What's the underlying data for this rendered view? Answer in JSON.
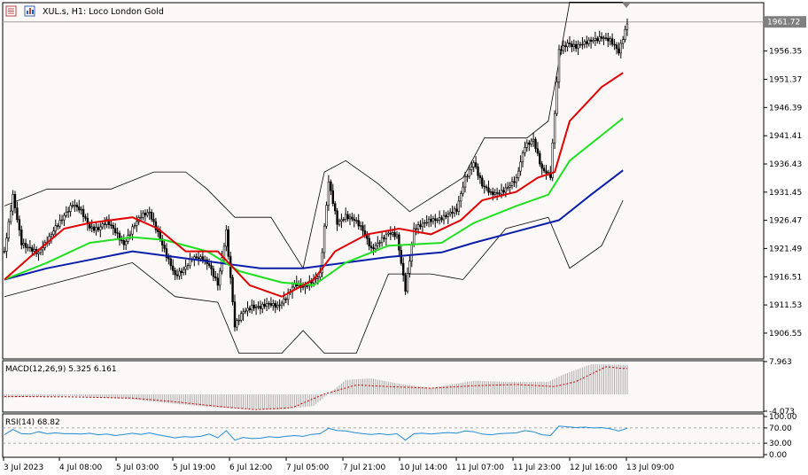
{
  "header": {
    "symbol_title": "XUL.s, H1:  Loco London Gold"
  },
  "colors": {
    "background": "#fdf8f8",
    "border": "#000000",
    "bollinger": "#000000",
    "ma_fast": "#e00000",
    "ma_mid": "#1ee01e",
    "ma_slow": "#0a1ea8",
    "macd_hist": "#a8a8a8",
    "macd_signal": "#d00000",
    "rsi_line": "#1e8cd2",
    "bid_line": "#a0a0a0",
    "bid_tag": "#808080"
  },
  "current_price_tag": "1961.72",
  "chart_data": [
    {
      "type": "candlestick",
      "price_axis_ticks": [
        "1956.35",
        "1951.37",
        "1946.39",
        "1941.41",
        "1936.43",
        "1931.45",
        "1926.47",
        "1921.49",
        "1916.51",
        "1911.53",
        "1906.55"
      ],
      "ylim": [
        1902.0,
        1964.9
      ],
      "time_axis_labels": [
        "3 Jul 2023",
        "4 Jul 08:00",
        "5 Jul 03:00",
        "5 Jul 19:00",
        "6 Jul 12:00",
        "7 Jul 05:00",
        "7 Jul 21:00",
        "10 Jul 14:00",
        "11 Jul 07:00",
        "11 Jul 23:00",
        "12 Jul 16:00",
        "13 Jul 09:00"
      ],
      "close_path": [
        [
          0,
          1921.0
        ],
        [
          4,
          1930.5
        ],
        [
          8,
          1922.5
        ],
        [
          12,
          1921.8
        ],
        [
          16,
          1920.5
        ],
        [
          20,
          1922.5
        ],
        [
          24,
          1925.5
        ],
        [
          28,
          1927.5
        ],
        [
          32,
          1929.0
        ],
        [
          36,
          1928.0
        ],
        [
          40,
          1925.5
        ],
        [
          44,
          1925.0
        ],
        [
          48,
          1926.0
        ],
        [
          52,
          1924.5
        ],
        [
          56,
          1922.5
        ],
        [
          60,
          1925.0
        ],
        [
          64,
          1927.0
        ],
        [
          68,
          1928.0
        ],
        [
          72,
          1924.5
        ],
        [
          76,
          1920.0
        ],
        [
          80,
          1916.5
        ],
        [
          84,
          1918.0
        ],
        [
          88,
          1920.0
        ],
        [
          92,
          1919.5
        ],
        [
          96,
          1918.5
        ],
        [
          100,
          1915.5
        ],
        [
          104,
          1924.5
        ],
        [
          108,
          1907.5
        ],
        [
          112,
          1910.5
        ],
        [
          116,
          1911.5
        ],
        [
          120,
          1911.0
        ],
        [
          124,
          1911.5
        ],
        [
          128,
          1911.5
        ],
        [
          132,
          1913.0
        ],
        [
          136,
          1915.0
        ],
        [
          140,
          1914.5
        ],
        [
          144,
          1916.0
        ],
        [
          148,
          1917.0
        ],
        [
          152,
          1933.0
        ],
        [
          156,
          1926.0
        ],
        [
          160,
          1927.5
        ],
        [
          164,
          1926.5
        ],
        [
          168,
          1924.5
        ],
        [
          172,
          1921.5
        ],
        [
          176,
          1923.0
        ],
        [
          180,
          1924.0
        ],
        [
          184,
          1923.5
        ],
        [
          188,
          1914.5
        ],
        [
          192,
          1925.0
        ],
        [
          196,
          1925.5
        ],
        [
          200,
          1926.5
        ],
        [
          204,
          1927.0
        ],
        [
          208,
          1927.5
        ],
        [
          212,
          1928.0
        ],
        [
          216,
          1934.0
        ],
        [
          220,
          1937.0
        ],
        [
          224,
          1932.5
        ],
        [
          228,
          1931.0
        ],
        [
          232,
          1931.5
        ],
        [
          236,
          1932.5
        ],
        [
          240,
          1933.5
        ],
        [
          244,
          1939.5
        ],
        [
          248,
          1941.0
        ],
        [
          252,
          1935.5
        ],
        [
          256,
          1934.0
        ],
        [
          260,
          1956.5
        ],
        [
          264,
          1958.0
        ],
        [
          268,
          1957.0
        ],
        [
          272,
          1957.5
        ],
        [
          276,
          1958.5
        ],
        [
          280,
          1959.0
        ],
        [
          284,
          1958.0
        ],
        [
          288,
          1956.0
        ],
        [
          292,
          1961.5
        ]
      ],
      "bollinger_upper_path": [
        [
          0,
          1929
        ],
        [
          20,
          1932
        ],
        [
          50,
          1932
        ],
        [
          70,
          1935
        ],
        [
          85,
          1935
        ],
        [
          95,
          1932
        ],
        [
          108,
          1927
        ],
        [
          125,
          1927
        ],
        [
          140,
          1918
        ],
        [
          150,
          1935
        ],
        [
          160,
          1937
        ],
        [
          175,
          1933
        ],
        [
          190,
          1928
        ],
        [
          215,
          1934
        ],
        [
          225,
          1941
        ],
        [
          245,
          1941
        ],
        [
          255,
          1944
        ],
        [
          265,
          1965
        ],
        [
          290,
          1965
        ]
      ],
      "bollinger_lower_path": [
        [
          0,
          1913
        ],
        [
          20,
          1915
        ],
        [
          40,
          1917
        ],
        [
          60,
          1919
        ],
        [
          80,
          1913
        ],
        [
          100,
          1912
        ],
        [
          110,
          1903
        ],
        [
          130,
          1903
        ],
        [
          140,
          1907
        ],
        [
          150,
          1903
        ],
        [
          165,
          1903
        ],
        [
          180,
          1917
        ],
        [
          200,
          1917
        ],
        [
          215,
          1916
        ],
        [
          235,
          1925
        ],
        [
          255,
          1927
        ],
        [
          265,
          1918
        ],
        [
          280,
          1922
        ],
        [
          290,
          1930
        ]
      ],
      "ma_fast_path": [
        [
          0,
          1916
        ],
        [
          12,
          1920
        ],
        [
          28,
          1925
        ],
        [
          40,
          1926
        ],
        [
          60,
          1927
        ],
        [
          72,
          1925
        ],
        [
          85,
          1921
        ],
        [
          100,
          1921
        ],
        [
          115,
          1915
        ],
        [
          130,
          1913
        ],
        [
          145,
          1916
        ],
        [
          155,
          1921
        ],
        [
          170,
          1924
        ],
        [
          185,
          1925
        ],
        [
          200,
          1924
        ],
        [
          214,
          1926.5
        ],
        [
          224,
          1930
        ],
        [
          240,
          1931.5
        ],
        [
          250,
          1934
        ],
        [
          258,
          1935
        ],
        [
          265,
          1944
        ],
        [
          280,
          1950
        ],
        [
          290,
          1952.5
        ]
      ],
      "ma_mid_path": [
        [
          0,
          1916
        ],
        [
          20,
          1919
        ],
        [
          40,
          1922.5
        ],
        [
          60,
          1923.5
        ],
        [
          75,
          1923
        ],
        [
          95,
          1921
        ],
        [
          110,
          1917.5
        ],
        [
          130,
          1915.5
        ],
        [
          145,
          1915
        ],
        [
          160,
          1919
        ],
        [
          180,
          1922
        ],
        [
          205,
          1922.5
        ],
        [
          220,
          1926
        ],
        [
          240,
          1929
        ],
        [
          255,
          1931
        ],
        [
          265,
          1937
        ],
        [
          280,
          1941.5
        ],
        [
          290,
          1944.5
        ]
      ],
      "ma_slow_path": [
        [
          0,
          1916
        ],
        [
          20,
          1918
        ],
        [
          40,
          1919.5
        ],
        [
          60,
          1921
        ],
        [
          80,
          1920
        ],
        [
          100,
          1919
        ],
        [
          120,
          1918
        ],
        [
          140,
          1918
        ],
        [
          160,
          1919
        ],
        [
          180,
          1920
        ],
        [
          205,
          1920.8
        ],
        [
          220,
          1922.5
        ],
        [
          240,
          1924.5
        ],
        [
          260,
          1926.5
        ],
        [
          275,
          1931
        ],
        [
          290,
          1935.3
        ]
      ]
    },
    {
      "type": "bar",
      "indicator_title": "MACD(12,26,9) 5.325 6.161",
      "axis_ticks": [
        "7.963",
        "-4.073"
      ],
      "ylim": [
        -4.073,
        7.963
      ],
      "hist_path": [
        [
          0,
          -0.8
        ],
        [
          30,
          -0.3
        ],
        [
          60,
          -1.2
        ],
        [
          80,
          -2.3
        ],
        [
          100,
          -3.2
        ],
        [
          115,
          -3.6
        ],
        [
          130,
          -3.7
        ],
        [
          145,
          -2.8
        ],
        [
          160,
          3.5
        ],
        [
          172,
          3.9
        ],
        [
          185,
          2.6
        ],
        [
          200,
          1.6
        ],
        [
          220,
          3.3
        ],
        [
          240,
          3.0
        ],
        [
          255,
          3.1
        ],
        [
          262,
          4.8
        ],
        [
          275,
          7.3
        ],
        [
          290,
          7.2
        ]
      ],
      "signal_path": [
        [
          0,
          -0.5
        ],
        [
          30,
          -0.6
        ],
        [
          60,
          -0.9
        ],
        [
          80,
          -1.8
        ],
        [
          100,
          -2.9
        ],
        [
          118,
          -3.7
        ],
        [
          135,
          -3.2
        ],
        [
          150,
          0.1
        ],
        [
          165,
          2.3
        ],
        [
          180,
          1.9
        ],
        [
          200,
          1.5
        ],
        [
          220,
          2.1
        ],
        [
          240,
          2.4
        ],
        [
          258,
          1.9
        ],
        [
          268,
          3.1
        ],
        [
          282,
          6.7
        ],
        [
          290,
          6.3
        ]
      ]
    },
    {
      "type": "line",
      "indicator_title": "RSI(14) 68.82",
      "axis_ticks": [
        "100.00",
        "70.00",
        "30.00",
        "0.00"
      ],
      "ylim": [
        0,
        100
      ],
      "values_path": [
        [
          0,
          52
        ],
        [
          4,
          66
        ],
        [
          8,
          55
        ],
        [
          12,
          54
        ],
        [
          16,
          60
        ],
        [
          20,
          55
        ],
        [
          24,
          57
        ],
        [
          28,
          55
        ],
        [
          32,
          55
        ],
        [
          36,
          54
        ],
        [
          40,
          56
        ],
        [
          44,
          52
        ],
        [
          48,
          54
        ],
        [
          52,
          50
        ],
        [
          56,
          53
        ],
        [
          60,
          56
        ],
        [
          64,
          53
        ],
        [
          68,
          57
        ],
        [
          72,
          52
        ],
        [
          76,
          48
        ],
        [
          80,
          44
        ],
        [
          84,
          47
        ],
        [
          88,
          46
        ],
        [
          92,
          48
        ],
        [
          96,
          54
        ],
        [
          100,
          44
        ],
        [
          104,
          63
        ],
        [
          108,
          38
        ],
        [
          112,
          45
        ],
        [
          116,
          42
        ],
        [
          120,
          43
        ],
        [
          124,
          47
        ],
        [
          128,
          45
        ],
        [
          132,
          48
        ],
        [
          136,
          50
        ],
        [
          140,
          48
        ],
        [
          144,
          53
        ],
        [
          148,
          55
        ],
        [
          152,
          69
        ],
        [
          156,
          63
        ],
        [
          160,
          62
        ],
        [
          164,
          58
        ],
        [
          168,
          55
        ],
        [
          172,
          53
        ],
        [
          176,
          55
        ],
        [
          180,
          52
        ],
        [
          184,
          55
        ],
        [
          188,
          38
        ],
        [
          192,
          55
        ],
        [
          196,
          56
        ],
        [
          200,
          54
        ],
        [
          204,
          56
        ],
        [
          208,
          58
        ],
        [
          212,
          56
        ],
        [
          216,
          62
        ],
        [
          220,
          60
        ],
        [
          224,
          54
        ],
        [
          228,
          52
        ],
        [
          232,
          55
        ],
        [
          236,
          56
        ],
        [
          240,
          57
        ],
        [
          244,
          63
        ],
        [
          248,
          60
        ],
        [
          252,
          52
        ],
        [
          256,
          50
        ],
        [
          260,
          75
        ],
        [
          264,
          73
        ],
        [
          268,
          71
        ],
        [
          272,
          72
        ],
        [
          276,
          70
        ],
        [
          280,
          71
        ],
        [
          284,
          68
        ],
        [
          288,
          62
        ],
        [
          292,
          69
        ]
      ]
    }
  ]
}
